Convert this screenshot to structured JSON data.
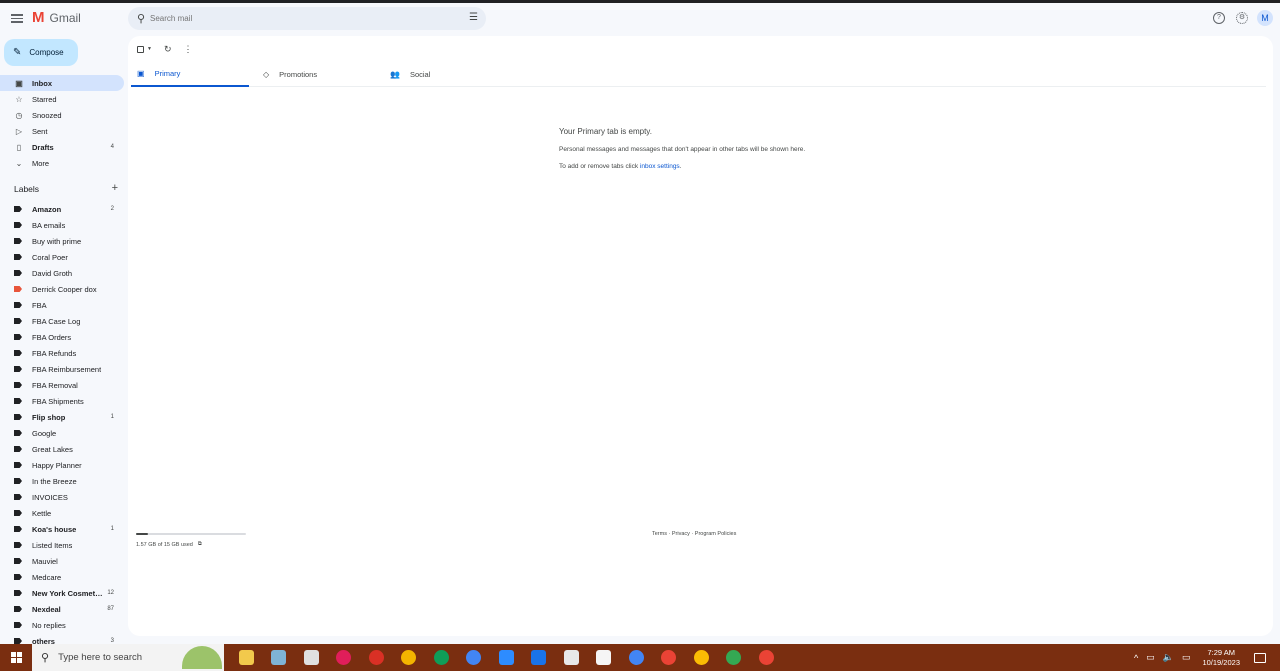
{
  "header": {
    "app_name": "Gmail",
    "logo_letter": "M",
    "search_placeholder": "Search mail",
    "avatar_initial": "M"
  },
  "compose_label": "Compose",
  "nav": [
    {
      "label": "Inbox",
      "icon": "inbox-icon",
      "glyph": "▣",
      "count": "",
      "active": true,
      "bold": true
    },
    {
      "label": "Starred",
      "icon": "star-icon",
      "glyph": "☆",
      "count": "",
      "active": false,
      "bold": false
    },
    {
      "label": "Snoozed",
      "icon": "clock-icon",
      "glyph": "◷",
      "count": "",
      "active": false,
      "bold": false
    },
    {
      "label": "Sent",
      "icon": "send-icon",
      "glyph": "▷",
      "count": "",
      "active": false,
      "bold": false
    },
    {
      "label": "Drafts",
      "icon": "draft-icon",
      "glyph": "▯",
      "count": "4",
      "active": false,
      "bold": true
    },
    {
      "label": "More",
      "icon": "chevron-down-icon",
      "glyph": "⌄",
      "count": "",
      "active": false,
      "bold": false
    }
  ],
  "labels_heading": "Labels",
  "labels": [
    {
      "label": "Amazon",
      "count": "2",
      "bold": true,
      "color": "#202124"
    },
    {
      "label": "BA emails",
      "count": "",
      "bold": false,
      "color": "#202124"
    },
    {
      "label": "Buy with prime",
      "count": "",
      "bold": false,
      "color": "#202124"
    },
    {
      "label": "Coral Poer",
      "count": "",
      "bold": false,
      "color": "#202124"
    },
    {
      "label": "David Groth",
      "count": "",
      "bold": false,
      "color": "#202124"
    },
    {
      "label": "Derrick Cooper dox",
      "count": "",
      "bold": false,
      "color": "#e8553b"
    },
    {
      "label": "FBA",
      "count": "",
      "bold": false,
      "color": "#202124"
    },
    {
      "label": "FBA Case Log",
      "count": "",
      "bold": false,
      "color": "#202124"
    },
    {
      "label": "FBA Orders",
      "count": "",
      "bold": false,
      "color": "#202124"
    },
    {
      "label": "FBA Refunds",
      "count": "",
      "bold": false,
      "color": "#202124"
    },
    {
      "label": "FBA Reimbursement",
      "count": "",
      "bold": false,
      "color": "#202124"
    },
    {
      "label": "FBA Removal",
      "count": "",
      "bold": false,
      "color": "#202124"
    },
    {
      "label": "FBA Shipments",
      "count": "",
      "bold": false,
      "color": "#202124"
    },
    {
      "label": "Flip shop",
      "count": "1",
      "bold": true,
      "color": "#202124"
    },
    {
      "label": "Google",
      "count": "",
      "bold": false,
      "color": "#202124"
    },
    {
      "label": "Great Lakes",
      "count": "",
      "bold": false,
      "color": "#202124"
    },
    {
      "label": "Happy Planner",
      "count": "",
      "bold": false,
      "color": "#202124"
    },
    {
      "label": "In the Breeze",
      "count": "",
      "bold": false,
      "color": "#202124"
    },
    {
      "label": "INVOICES",
      "count": "",
      "bold": false,
      "color": "#202124"
    },
    {
      "label": "Kettle",
      "count": "",
      "bold": false,
      "color": "#202124"
    },
    {
      "label": "Koa's house",
      "count": "1",
      "bold": true,
      "color": "#202124"
    },
    {
      "label": "Listed Items",
      "count": "",
      "bold": false,
      "color": "#202124"
    },
    {
      "label": "Mauviel",
      "count": "",
      "bold": false,
      "color": "#202124"
    },
    {
      "label": "Medcare",
      "count": "",
      "bold": false,
      "color": "#202124"
    },
    {
      "label": "New York Cosmet…",
      "count": "12",
      "bold": true,
      "color": "#202124"
    },
    {
      "label": "Nexdeal",
      "count": "87",
      "bold": true,
      "color": "#202124"
    },
    {
      "label": "No replies",
      "count": "",
      "bold": false,
      "color": "#202124"
    },
    {
      "label": "others",
      "count": "3",
      "bold": true,
      "color": "#202124"
    }
  ],
  "tabs": [
    {
      "label": "Primary",
      "icon": "inbox-icon",
      "glyph": "▣",
      "active": true
    },
    {
      "label": "Promotions",
      "icon": "tag-icon",
      "glyph": "◇",
      "active": false
    },
    {
      "label": "Social",
      "icon": "people-icon",
      "glyph": "👥",
      "active": false
    }
  ],
  "empty_state": {
    "title": "Your Primary tab is empty.",
    "description": "Personal messages and messages that don't appear in other tabs will be shown here.",
    "hint_prefix": "To add or remove tabs click ",
    "hint_link": "inbox settings",
    "hint_suffix": "."
  },
  "storage": {
    "text": "1.57 GB of 15 GB used",
    "fraction": 0.105
  },
  "footer_links": "Terms · Privacy · Program Policies",
  "taskbar": {
    "search_placeholder": "Type here to search",
    "time": "7:29 AM",
    "date": "10/19/2023",
    "apps": [
      {
        "name": "file-explorer-icon",
        "color": "#f2c94c",
        "round": false
      },
      {
        "name": "notepad-icon",
        "color": "#7fb3d5",
        "round": false
      },
      {
        "name": "calculator-icon",
        "color": "#e0e0e0",
        "round": false
      },
      {
        "name": "slack-icon",
        "color": "#e01e5a",
        "round": true
      },
      {
        "name": "chrome-icon",
        "color": "#d93025",
        "round": true
      },
      {
        "name": "chrome-icon",
        "color": "#f4b400",
        "round": true
      },
      {
        "name": "chrome-icon",
        "color": "#0f9d58",
        "round": true
      },
      {
        "name": "chrome-icon",
        "color": "#4285f4",
        "round": true
      },
      {
        "name": "zoom-icon",
        "color": "#2d8cff",
        "round": false
      },
      {
        "name": "r-app-icon",
        "color": "#1a73e8",
        "round": false
      },
      {
        "name": "app-icon",
        "color": "#e8e8e8",
        "round": false
      },
      {
        "name": "app-icon",
        "color": "#f5f5f5",
        "round": false
      },
      {
        "name": "chrome-icon",
        "color": "#4285f4",
        "round": true
      },
      {
        "name": "chrome-icon",
        "color": "#ea4335",
        "round": true
      },
      {
        "name": "chrome-icon",
        "color": "#fbbc04",
        "round": true
      },
      {
        "name": "chrome-icon",
        "color": "#34a853",
        "round": true
      },
      {
        "name": "chrome-icon",
        "color": "#ea4335",
        "round": true
      }
    ]
  }
}
